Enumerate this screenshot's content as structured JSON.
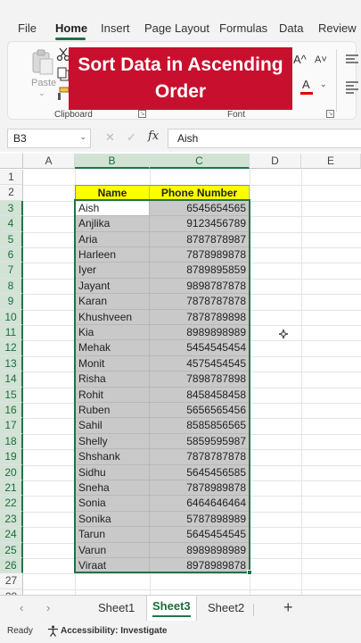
{
  "ribbon": {
    "tabs": [
      "File",
      "Home",
      "Insert",
      "Page Layout",
      "Formulas",
      "Data",
      "Review"
    ],
    "active_tab": "Home",
    "paste_label": "Paste",
    "clipboard_label": "Clipboard",
    "font_label": "Font",
    "grow_font": "A^",
    "shrink_font": "A˅",
    "font_color_glyph": "A"
  },
  "banner": {
    "line1": "Sort Data in Ascending",
    "line2": "Order"
  },
  "formula_bar": {
    "name_box": "B3",
    "fx": "fx",
    "value": "Aish"
  },
  "grid": {
    "columns": [
      "A",
      "B",
      "C",
      "D",
      "E"
    ],
    "selected_columns": [
      "B",
      "C"
    ],
    "rows": [
      "1",
      "2",
      "3",
      "4",
      "5",
      "6",
      "7",
      "8",
      "9",
      "10",
      "11",
      "12",
      "13",
      "14",
      "15",
      "16",
      "17",
      "18",
      "19",
      "20",
      "21",
      "22",
      "23",
      "24",
      "25",
      "26",
      "27",
      "28"
    ],
    "header": {
      "name": "Name",
      "phone": "Phone Number"
    },
    "records": [
      {
        "name": "Aish",
        "phone": "6545654565"
      },
      {
        "name": "Anjlika",
        "phone": "9123456789"
      },
      {
        "name": "Aria",
        "phone": "8787878987"
      },
      {
        "name": "Harleen",
        "phone": "7878989878"
      },
      {
        "name": "Iyer",
        "phone": "8789895859"
      },
      {
        "name": "Jayant",
        "phone": "9898787878"
      },
      {
        "name": "Karan",
        "phone": "7878787878"
      },
      {
        "name": "Khushveen",
        "phone": "7878789898"
      },
      {
        "name": "Kia",
        "phone": "8989898989"
      },
      {
        "name": "Mehak",
        "phone": "5454545454"
      },
      {
        "name": "Monit",
        "phone": "4575454545"
      },
      {
        "name": "Risha",
        "phone": "7898787898"
      },
      {
        "name": "Rohit",
        "phone": "8458458458"
      },
      {
        "name": "Ruben",
        "phone": "5656565456"
      },
      {
        "name": "Sahil",
        "phone": "8585856565"
      },
      {
        "name": "Shelly",
        "phone": "5859595987"
      },
      {
        "name": "Shshank",
        "phone": "7878787878"
      },
      {
        "name": "Sidhu",
        "phone": "5645456585"
      },
      {
        "name": "Sneha",
        "phone": "7878989878"
      },
      {
        "name": "Sonia",
        "phone": "6464646464"
      },
      {
        "name": "Sonika",
        "phone": "5787898989"
      },
      {
        "name": "Tarun",
        "phone": "5645454545"
      },
      {
        "name": "Varun",
        "phone": "8989898989"
      },
      {
        "name": "Viraat",
        "phone": "8978989878"
      }
    ]
  },
  "sheets": {
    "tabs": [
      "Sheet1",
      "Sheet3",
      "Sheet2"
    ],
    "active": "Sheet3"
  },
  "status": {
    "ready": "Ready",
    "accessibility": "Accessibility: Investigate"
  },
  "colors": {
    "accent": "#217346",
    "banner": "#c8102e",
    "header_fill": "#ffff00",
    "selection_shade": "#c9c9c9"
  }
}
